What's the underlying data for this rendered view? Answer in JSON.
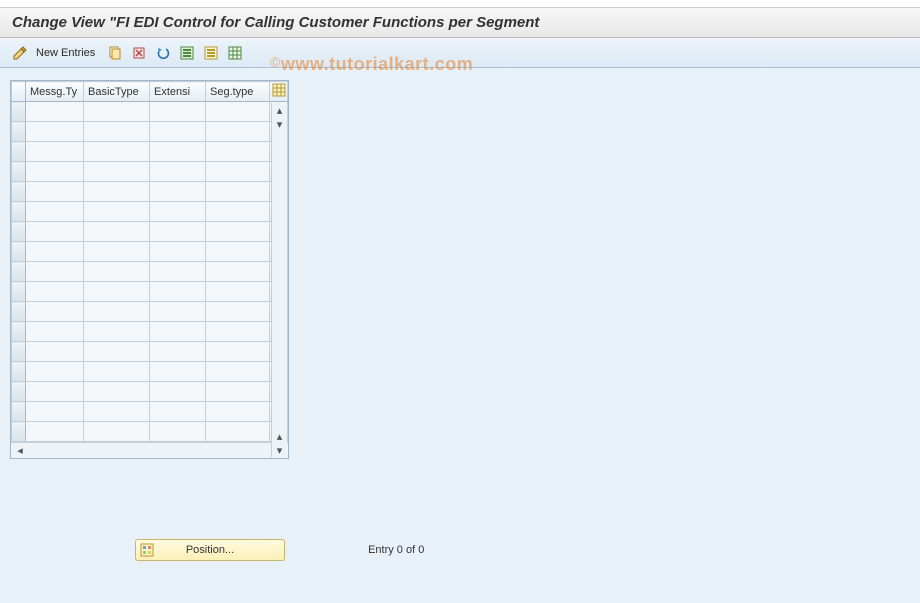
{
  "title": "Change View \"FI EDI Control for Calling Customer Functions per Segment",
  "toolbar": {
    "new_entries_label": "New Entries"
  },
  "table": {
    "columns": [
      "Messg.Ty",
      "BasicType",
      "Extensi",
      "Seg.type"
    ],
    "row_count": 17
  },
  "bottom": {
    "position_label": "Position...",
    "entry_status": "Entry 0 of 0"
  },
  "watermark": "www.tutorialkart.com"
}
